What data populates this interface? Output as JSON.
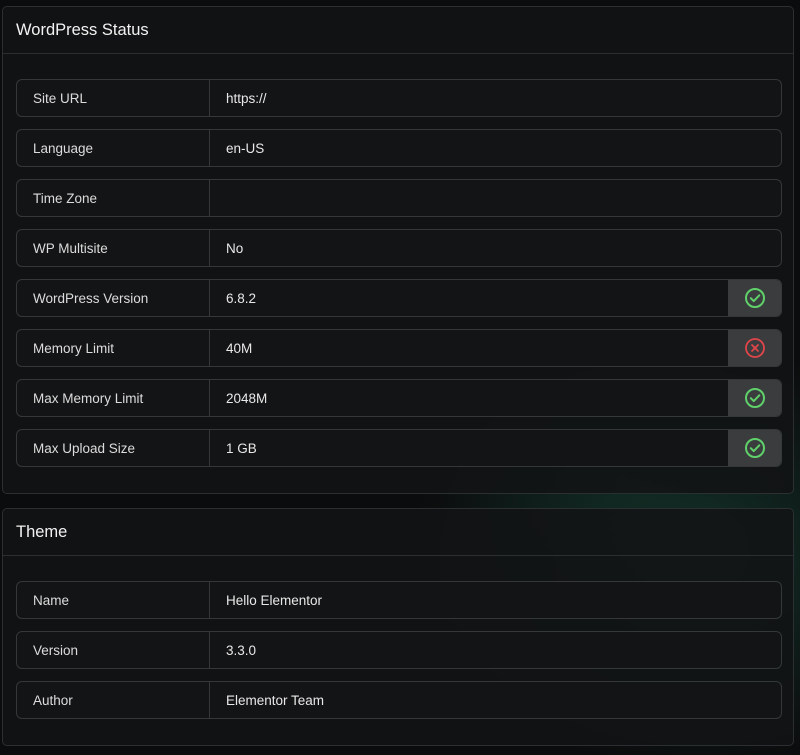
{
  "colors": {
    "ok": "#5fd06a",
    "error": "#e0454a",
    "accent_glow": "#184638"
  },
  "wordpress_status": {
    "title": "WordPress Status",
    "rows": [
      {
        "label": "Site URL",
        "value": "https://"
      },
      {
        "label": "Language",
        "value": "en-US"
      },
      {
        "label": "Time Zone",
        "value": ""
      },
      {
        "label": "WP Multisite",
        "value": "No"
      },
      {
        "label": "WordPress Version",
        "value": "6.8.2",
        "status": "ok",
        "icon": "check-circle-icon"
      },
      {
        "label": "Memory Limit",
        "value": "40M",
        "status": "error",
        "icon": "x-circle-icon"
      },
      {
        "label": "Max Memory Limit",
        "value": "2048M",
        "status": "ok",
        "icon": "check-circle-icon"
      },
      {
        "label": "Max Upload Size",
        "value": "1 GB",
        "status": "ok",
        "icon": "check-circle-icon"
      }
    ]
  },
  "theme": {
    "title": "Theme",
    "rows": [
      {
        "label": "Name",
        "value": "Hello Elementor"
      },
      {
        "label": "Version",
        "value": "3.3.0"
      },
      {
        "label": "Author",
        "value": "Elementor Team"
      }
    ]
  }
}
